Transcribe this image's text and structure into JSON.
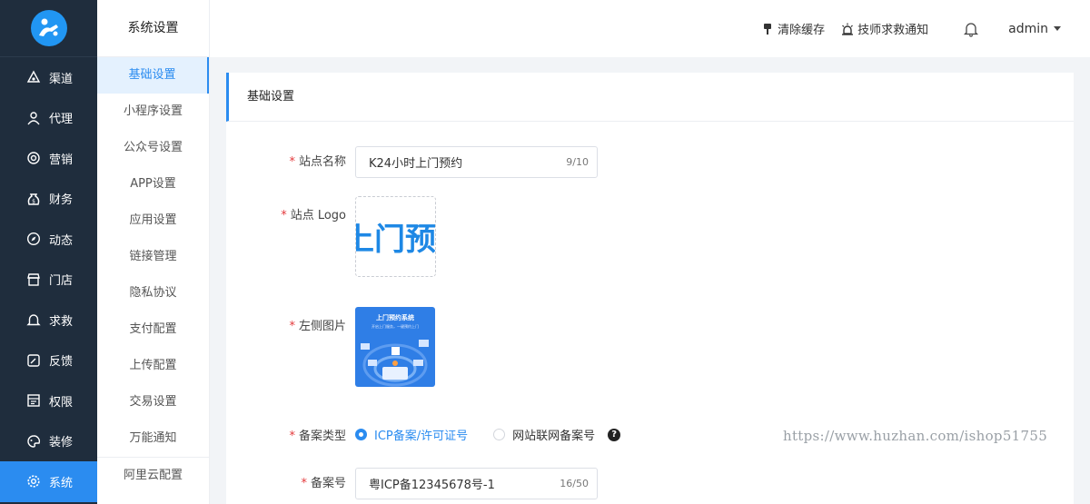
{
  "colors": {
    "sidebar_bg": "#1f2d3d",
    "accent": "#2b8cf0",
    "required": "#e4393c"
  },
  "sidebar": {
    "items": [
      {
        "label": "渠道",
        "icon": "channel-icon"
      },
      {
        "label": "代理",
        "icon": "user-icon"
      },
      {
        "label": "营销",
        "icon": "target-icon"
      },
      {
        "label": "财务",
        "icon": "money-bag-icon"
      },
      {
        "label": "动态",
        "icon": "compass-icon"
      },
      {
        "label": "门店",
        "icon": "store-icon"
      },
      {
        "label": "求救",
        "icon": "bell-icon"
      },
      {
        "label": "反馈",
        "icon": "feedback-icon"
      },
      {
        "label": "权限",
        "icon": "permission-icon"
      },
      {
        "label": "装修",
        "icon": "palette-icon"
      },
      {
        "label": "系统",
        "icon": "gear-icon",
        "active": true
      }
    ]
  },
  "subnav": {
    "title": "系统设置",
    "items": [
      "基础设置",
      "小程序设置",
      "公众号设置",
      "APP设置",
      "应用设置",
      "链接管理",
      "隐私协议",
      "支付配置",
      "上传配置",
      "交易设置",
      "万能通知",
      "阿里云配置"
    ],
    "active_index": 0
  },
  "header": {
    "clear_cache": "清除缓存",
    "technician_alert": "技师求救通知",
    "user": "admin"
  },
  "card": {
    "title": "基础设置"
  },
  "form": {
    "site_name": {
      "label": "站点名称",
      "value": "K24小时上门预约",
      "count": "9/10"
    },
    "site_logo": {
      "label": "站点 Logo",
      "logo_text": "上门预"
    },
    "left_image": {
      "label": "左侧图片",
      "image_title": "上门预约系统",
      "image_subtitle": "开启上门服务，一键预约上门"
    },
    "record_type": {
      "label": "备案类型",
      "options": [
        "ICP备案/许可证号",
        "网站联网备案号"
      ],
      "selected": 0
    },
    "record_no": {
      "label": "备案号",
      "value": "粤ICP备12345678号-1",
      "count": "16/50"
    }
  },
  "watermark": "https://www.huzhan.com/ishop51755"
}
